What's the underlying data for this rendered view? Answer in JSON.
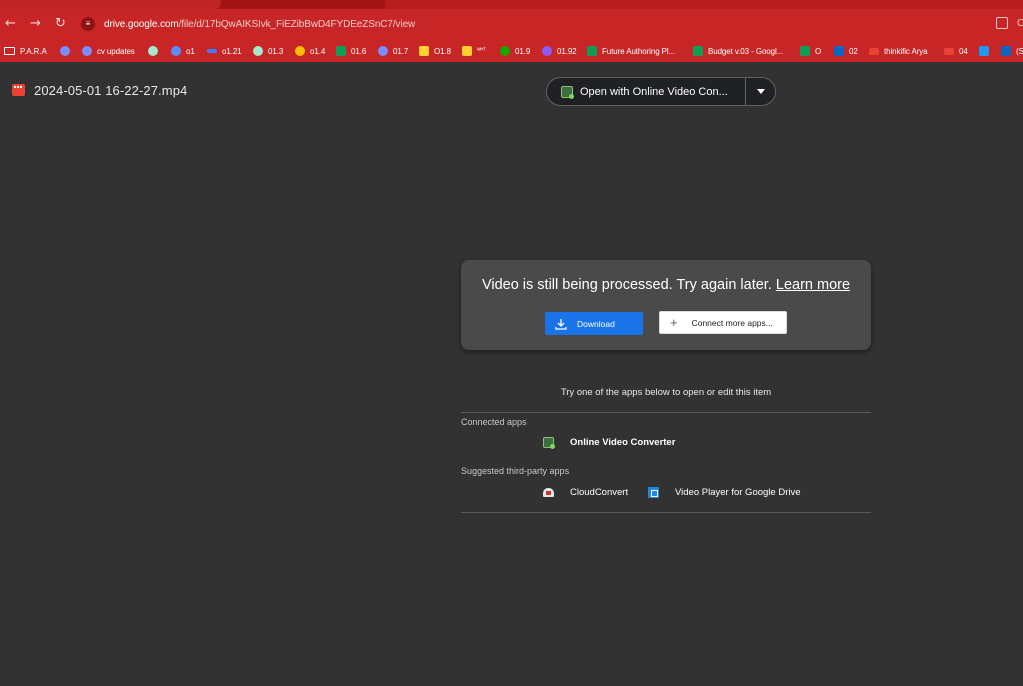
{
  "browser": {
    "url_host": "drive.google.com",
    "url_path": "/file/d/17bQwAIKSIvk_FiEZibBwD4FYDEeZSnC7/view",
    "back_icon": "back-arrow-icon",
    "forward_icon": "forward-arrow-icon",
    "reload_icon": "reload-icon"
  },
  "bookmarks": [
    {
      "label": "P.A.R.A",
      "icon": "folder-icon",
      "color": "#ffffff"
    },
    {
      "label": "",
      "icon": "wordpress-icon",
      "color": "#7b8cff"
    },
    {
      "label": "cv updates",
      "icon": "wordpress-icon",
      "color": "#7b8cff"
    },
    {
      "label": "",
      "icon": "openai-icon",
      "color": "#a8e6cf"
    },
    {
      "label": "o1",
      "icon": "messenger-icon",
      "color": "#5b8cff"
    },
    {
      "label": "o1.21",
      "icon": "link-icon",
      "color": "#3d7bff"
    },
    {
      "label": "01.3",
      "icon": "openai-icon",
      "color": "#a8e6cf"
    },
    {
      "label": "o1.4",
      "icon": "drive-icon",
      "color": "#fbbc04"
    },
    {
      "label": "01.6",
      "icon": "sheets-icon",
      "color": "#0f9d58"
    },
    {
      "label": "01.7",
      "icon": "wordpress-icon",
      "color": "#7b8cff"
    },
    {
      "label": "O1.8",
      "icon": "miro-icon",
      "color": "#ffd02f"
    },
    {
      "label": "",
      "icon": "miro-icon",
      "color": "#ffd02f"
    },
    {
      "label": "01.9",
      "icon": "upwork-icon",
      "color": "#14a800"
    },
    {
      "label": "01.92",
      "icon": "gear-icon",
      "color": "#8a5cf6"
    },
    {
      "label": "Future Authoring Pl...",
      "icon": "sheets-icon",
      "color": "#0f9d58"
    },
    {
      "label": "Budget v.03 - Googl...",
      "icon": "sheets-icon",
      "color": "#0f9d58"
    },
    {
      "label": "O",
      "icon": "sheets-icon",
      "color": "#0f9d58"
    },
    {
      "label": "02",
      "icon": "linkedin-icon",
      "color": "#0a66c2"
    },
    {
      "label": "thinkific Arya",
      "icon": "gmail-icon",
      "color": "#ea4335"
    },
    {
      "label": "04",
      "icon": "gmail-icon",
      "color": "#ea4335"
    },
    {
      "label": "",
      "icon": "tab-icon",
      "color": "#2196f3"
    },
    {
      "label": "(S",
      "icon": "linkedin-icon",
      "color": "#0a66c2"
    }
  ],
  "file": {
    "name": "2024-05-01 16-22-27.mp4",
    "icon": "video-file-icon"
  },
  "open_with": {
    "label": "Open with Online Video Con...",
    "app_icon": "online-video-converter-icon"
  },
  "processing_card": {
    "message": "Video is still being processed. Try again later.",
    "learn_more": "Learn more",
    "download_label": "Download",
    "connect_label": "Connect more apps..."
  },
  "apps_panel": {
    "intro": "Try one of the apps below to open or edit this item",
    "connected_heading": "Connected apps",
    "connected": [
      {
        "label": "Online Video Converter",
        "icon": "online-video-converter-icon"
      }
    ],
    "suggested_heading": "Suggested third-party apps",
    "suggested": [
      {
        "label": "CloudConvert",
        "icon": "cloudconvert-icon"
      },
      {
        "label": "Video Player for Google Drive",
        "icon": "video-player-icon"
      }
    ]
  },
  "colors": {
    "chrome_red": "#c82626",
    "viewer_bg": "#323232",
    "card_bg": "#4a4a4a",
    "primary_blue": "#1a73e8"
  }
}
